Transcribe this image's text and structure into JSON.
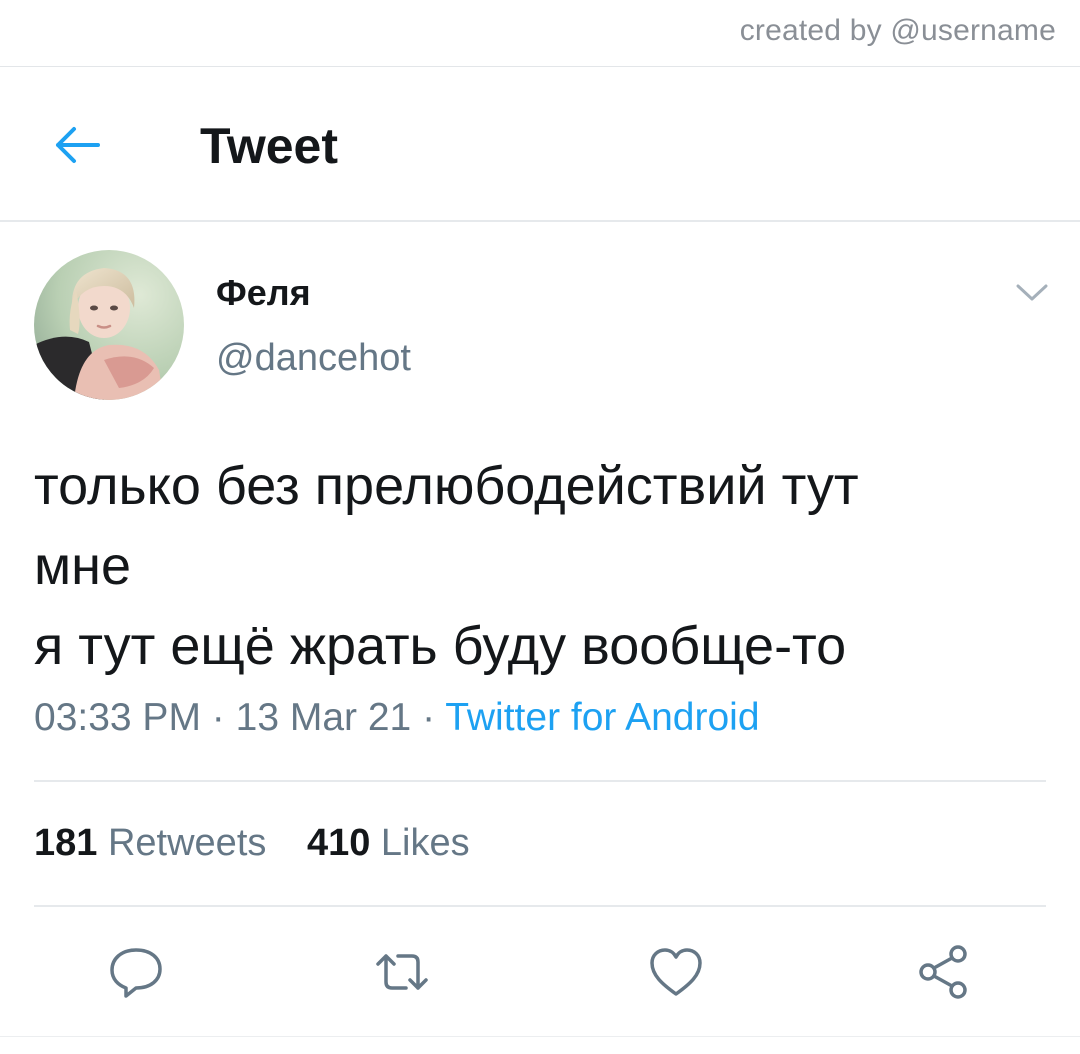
{
  "watermark": "created by @username",
  "header": {
    "title": "Tweet",
    "back_icon": "arrow-left-icon"
  },
  "tweet": {
    "author": {
      "display_name": "Феля",
      "handle": "@dancehot"
    },
    "text_lines": [
      "только без прелюбодействий тут",
      "мне",
      "я тут ещё жрать буду вообще-то"
    ],
    "time": "03:33 PM",
    "date": "13 Mar 21",
    "separator": "·",
    "source": "Twitter for Android",
    "stats": {
      "retweets_count": "181",
      "retweets_label": "Retweets",
      "likes_count": "410",
      "likes_label": "Likes"
    }
  },
  "actions": [
    "reply-icon",
    "retweet-icon",
    "like-icon",
    "share-icon"
  ],
  "colors": {
    "accent": "#1da1f2",
    "secondary_text": "#657786",
    "primary_text": "#14171a",
    "icon": "#657786"
  }
}
